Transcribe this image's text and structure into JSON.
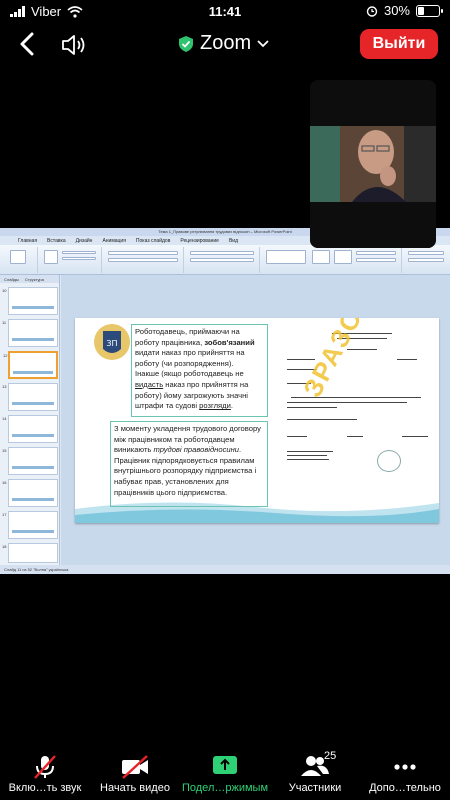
{
  "status_bar": {
    "carrier": "Viber",
    "time": "11:41",
    "battery": "30%",
    "battery_level": 0.3
  },
  "top_bar": {
    "app_title": "Zoom",
    "leave_label": "Выйти"
  },
  "ppt": {
    "window_title": "Тема 1_Правове регулювання трудових відносин – Microsoft PowerPoint",
    "tabs": [
      "Главная",
      "Вставка",
      "Дизайн",
      "Анимация",
      "Показ слайдов",
      "Рецензирование",
      "Вид"
    ],
    "pane_tabs": [
      "Слайды",
      "Структура"
    ],
    "slide_numbers": [
      "10",
      "11",
      "12",
      "13",
      "14",
      "15",
      "16",
      "17",
      "18"
    ],
    "status": "Слайд 11 из 52   \"Волна\"   українська",
    "slide": {
      "box1": {
        "p1": "Роботодавець, приймаючи на роботу працівника, ",
        "bold": "зобов'язаний",
        "p2": " видати наказ про прийняття на роботу (чи розпорядження).",
        "p3": "Інакше (якщо роботодавець не ",
        "underlined": "видасть",
        "p4": " наказ про прийняття на роботу) йому загрожують значні штрафи та судові ",
        "underlined2": "розгляди",
        "p5": "."
      },
      "box2": {
        "p1": "З моменту укладення трудового договору між працівником та роботодавцем виникають ",
        "italic": "трудові правовідносини",
        "p2": ". Працівник підпорядковується правилам внутрішнього розпорядку підприємства і набуває прав, установлених для працівників цього підприємства."
      },
      "watermark": "ЗРАЗОК"
    }
  },
  "bottom_bar": {
    "mute": "Вклю…ть звук",
    "video": "Начать видео",
    "share": "Подел…ржимым",
    "participants": "Участники",
    "participants_count": "25",
    "more": "Допо…тельно"
  }
}
